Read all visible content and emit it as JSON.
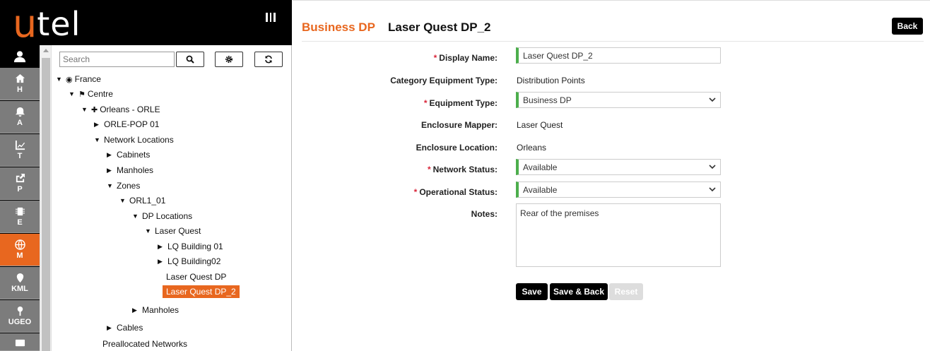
{
  "app": {
    "logo_first": "u",
    "logo_rest": "tel"
  },
  "nav": {
    "items": [
      {
        "label": "H",
        "icon": "home-icon"
      },
      {
        "label": "A",
        "icon": "bell-icon"
      },
      {
        "label": "T",
        "icon": "chart-icon"
      },
      {
        "label": "P",
        "icon": "share-icon"
      },
      {
        "label": "E",
        "icon": "chip-icon"
      },
      {
        "label": "M",
        "icon": "globe-icon",
        "active": true
      },
      {
        "label": "KML",
        "icon": "map-pin-icon"
      },
      {
        "label": "UGEO",
        "icon": "pin-icon"
      }
    ]
  },
  "tree": {
    "search_placeholder": "Search",
    "nodes": [
      {
        "label": "France",
        "toggle": "▼",
        "glyph": "🌐"
      },
      {
        "label": "Centre",
        "toggle": "▼",
        "glyph": "⚑"
      },
      {
        "label": "Orleans - ORLE",
        "toggle": "▼",
        "glyph": "📌"
      },
      {
        "label": "ORLE-POP 01",
        "toggle": "▶"
      },
      {
        "label": "Network Locations",
        "toggle": "▼"
      },
      {
        "label": "Cabinets",
        "toggle": "▶"
      },
      {
        "label": "Manholes",
        "toggle": "▶"
      },
      {
        "label": "Zones",
        "toggle": "▼"
      },
      {
        "label": "ORL1_01",
        "toggle": "▼"
      },
      {
        "label": "DP Locations",
        "toggle": "▼"
      },
      {
        "label": "Laser Quest",
        "toggle": "▼"
      },
      {
        "label": "LQ Building 01",
        "toggle": "▶"
      },
      {
        "label": "LQ Building02",
        "toggle": "▶"
      },
      {
        "label": "Laser Quest DP",
        "toggle": ""
      },
      {
        "label": "Laser Quest DP_2",
        "toggle": "",
        "selected": true
      },
      {
        "label": "Manholes",
        "toggle": "▶"
      },
      {
        "label": "Cables",
        "toggle": "▶"
      },
      {
        "label": "Preallocated Networks",
        "toggle": ""
      }
    ]
  },
  "form": {
    "title_type": "Business DP",
    "title_name": "Laser Quest DP_2",
    "back_label": "Back",
    "required_mark": "*",
    "display_name_label": "Display Name:",
    "display_name_value": "Laser Quest DP_2",
    "category_label": "Category Equipment Type:",
    "category_value": "Distribution Points",
    "equipment_type_label": "Equipment Type:",
    "equipment_type_value": "Business DP",
    "enclosure_mapper_label": "Enclosure Mapper:",
    "enclosure_mapper_value": "Laser Quest",
    "enclosure_location_label": "Enclosure Location:",
    "enclosure_location_value": "Orleans",
    "network_status_label": "Network Status:",
    "network_status_value": "Available",
    "operational_status_label": "Operational Status:",
    "operational_status_value": "Available",
    "notes_label": "Notes:",
    "notes_value": "Rear of the premises",
    "save_label": "Save",
    "save_back_label": "Save & Back",
    "reset_label": "Reset"
  },
  "colors": {
    "accent": "#e8671f",
    "valid": "#4cae4c",
    "required": "#d9263a"
  }
}
